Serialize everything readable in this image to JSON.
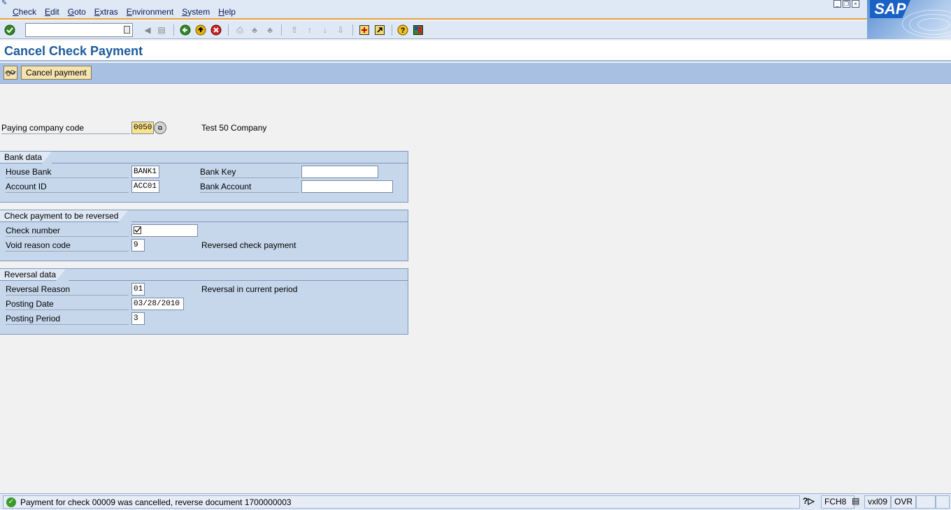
{
  "menu": {
    "items": [
      "Check",
      "Edit",
      "Goto",
      "Extras",
      "Environment",
      "System",
      "Help"
    ]
  },
  "logo_text": "SAP",
  "command_field": {
    "value": ""
  },
  "page_title": "Cancel Check Payment",
  "app_toolbar": {
    "cancel_payment_label": "Cancel payment"
  },
  "header": {
    "paying_company_code_label": "Paying company code",
    "paying_company_code_value": "0050",
    "company_name": "Test 50 Company"
  },
  "bank_data": {
    "title": "Bank data",
    "house_bank_label": "House Bank",
    "house_bank_value": "BANK1",
    "account_id_label": "Account ID",
    "account_id_value": "ACC01",
    "bank_key_label": "Bank Key",
    "bank_key_value": "",
    "bank_account_label": "Bank Account",
    "bank_account_value": ""
  },
  "check_payment": {
    "title": "Check payment to be reversed",
    "check_number_label": "Check number",
    "check_number_value": "",
    "void_reason_label": "Void reason code",
    "void_reason_value": "9",
    "void_reason_text": "Reversed check payment"
  },
  "reversal_data": {
    "title": "Reversal data",
    "reversal_reason_label": "Reversal Reason",
    "reversal_reason_value": "01",
    "reversal_reason_text": "Reversal in current period",
    "posting_date_label": "Posting Date",
    "posting_date_value": "03/28/2010",
    "posting_period_label": "Posting Period",
    "posting_period_value": "3"
  },
  "status_bar": {
    "message": "Payment for check 00009 was cancelled, reverse document 1700000003",
    "transaction": "FCH8",
    "server": "vxl09",
    "mode": "OVR"
  },
  "colors": {
    "accent_orange": "#e8a33c",
    "title_blue": "#1c5a9b",
    "group_bg": "#c6d7ec",
    "button_bg": "#f6e4b0",
    "success_green": "#3c9a2a"
  }
}
